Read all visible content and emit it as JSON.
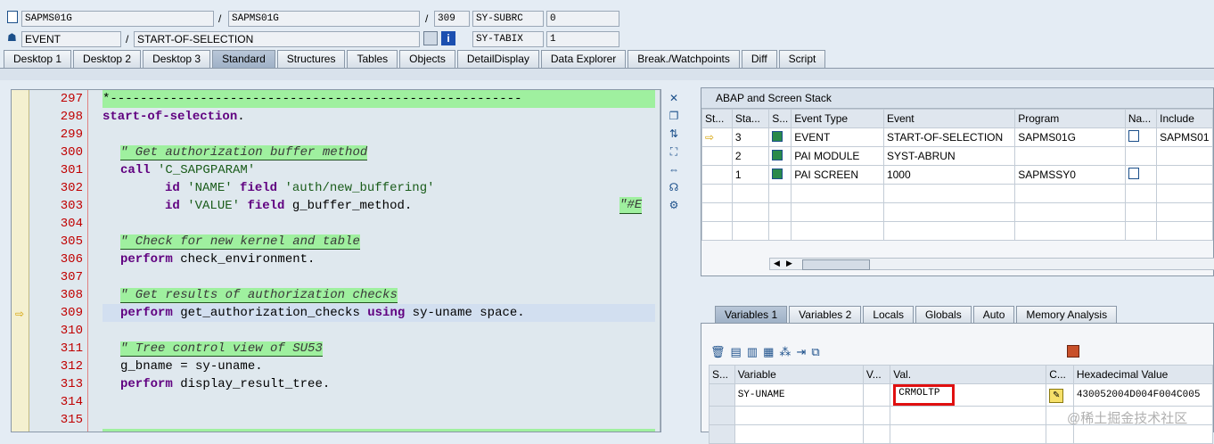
{
  "header": {
    "program1": "SAPMS01G",
    "program2": "SAPMS01G",
    "line": "309",
    "subrc_label": "SY-SUBRC",
    "subrc_value": "0",
    "event_type": "EVENT",
    "event_name": "START-OF-SELECTION",
    "tabix_label": "SY-TABIX",
    "tabix_value": "1",
    "slash": "/"
  },
  "tabs": [
    "Desktop 1",
    "Desktop 2",
    "Desktop 3",
    "Standard",
    "Structures",
    "Tables",
    "Objects",
    "DetailDisplay",
    "Data Explorer",
    "Break./Watchpoints",
    "Diff",
    "Script"
  ],
  "active_tab": "Standard",
  "editor": {
    "lines": [
      {
        "no": "297",
        "text": "*-------------------------------------------------------"
      },
      {
        "no": "298",
        "text": "start-of-selection."
      },
      {
        "no": "299",
        "text": ""
      },
      {
        "no": "300",
        "text": "\" Get authorization buffer method"
      },
      {
        "no": "301",
        "text": "call 'C_SAPGPARAM'"
      },
      {
        "no": "302",
        "text": "id 'NAME' field 'auth/new_buffering'"
      },
      {
        "no": "303",
        "text": "id 'VALUE' field g_buffer_method."
      },
      {
        "no": "304",
        "text": ""
      },
      {
        "no": "305",
        "text": "\" Check for new kernel and table"
      },
      {
        "no": "306",
        "text": "perform check_environment."
      },
      {
        "no": "307",
        "text": ""
      },
      {
        "no": "308",
        "text": "\" Get results of authorization checks"
      },
      {
        "no": "309",
        "text": "perform get_authorization_checks using sy-uname space."
      },
      {
        "no": "310",
        "text": ""
      },
      {
        "no": "311",
        "text": "\" Tree control view of SU53"
      },
      {
        "no": "312",
        "text": "g_bname = sy-uname."
      },
      {
        "no": "313",
        "text": "perform display_result_tree."
      },
      {
        "no": "314",
        "text": ""
      },
      {
        "no": "315",
        "text": ""
      }
    ],
    "trailing_comment": "\"#E",
    "current_line": "309"
  },
  "stack": {
    "title": "ABAP and Screen Stack",
    "columns": [
      "St...",
      "Sta...",
      "S...",
      "Event Type",
      "Event",
      "Program",
      "Na...",
      "Include"
    ],
    "rows": [
      {
        "level": "3",
        "event_type": "EVENT",
        "event": "START-OF-SELECTION",
        "program": "SAPMS01G",
        "include": "SAPMS01"
      },
      {
        "level": "2",
        "event_type": "PAI MODULE",
        "event": "SYST-ABRUN",
        "program": "",
        "include": ""
      },
      {
        "level": "1",
        "event_type": "PAI SCREEN",
        "event": "1000",
        "program": "SAPMSSY0",
        "include": ""
      }
    ]
  },
  "var_tabs": [
    "Variables 1",
    "Variables 2",
    "Locals",
    "Globals",
    "Auto",
    "Memory Analysis"
  ],
  "active_var_tab": "Variables 1",
  "variables": {
    "columns": [
      "S...",
      "Variable",
      "V...",
      "Val.",
      "C...",
      "Hexadecimal Value"
    ],
    "rows": [
      {
        "variable": "SY-UNAME",
        "value": "CRMOLTP",
        "hex": "430052004D004F004C005"
      }
    ]
  },
  "watermark": "@稀土掘金技术社区"
}
